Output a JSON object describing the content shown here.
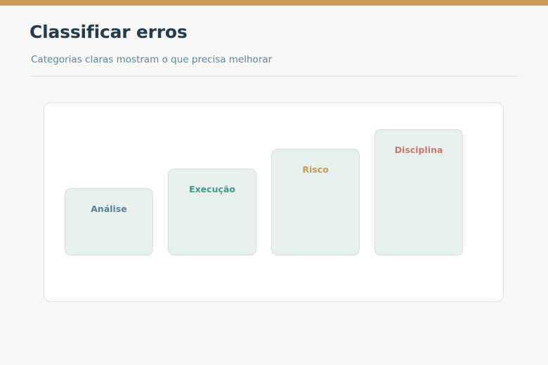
{
  "header": {
    "title": "Classificar erros",
    "subtitle": "Categorias claras mostram o que precisa melhorar"
  },
  "categories": [
    {
      "label": "Análise",
      "level": 1,
      "color": "#5a7f99"
    },
    {
      "label": "Execução",
      "level": 2,
      "color": "#3e9a88"
    },
    {
      "label": "Risco",
      "level": 3,
      "color": "#c69a52"
    },
    {
      "label": "Disciplina",
      "level": 4,
      "color": "#c47a70"
    }
  ]
}
